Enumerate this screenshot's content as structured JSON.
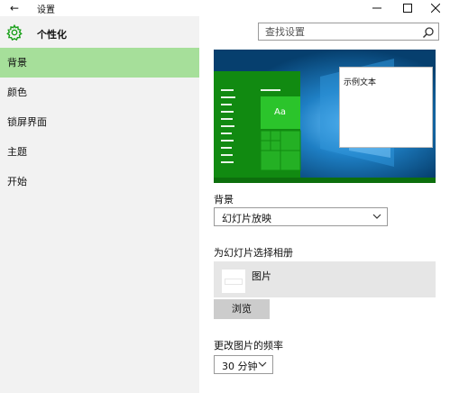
{
  "window": {
    "title": "设置",
    "back_icon": "back-arrow-icon",
    "minimize_icon": "minimize-icon",
    "maximize_icon": "maximize-icon",
    "close_icon": "close-icon"
  },
  "header": {
    "title": "个性化",
    "icon": "gear-icon",
    "accent_color": "#1aa01a"
  },
  "search": {
    "placeholder": "查找设置",
    "icon": "search-icon"
  },
  "sidebar": {
    "selected_color": "#a6df9a",
    "items": [
      {
        "label": "背景",
        "selected": true
      },
      {
        "label": "颜色",
        "selected": false
      },
      {
        "label": "锁屏界面",
        "selected": false
      },
      {
        "label": "主题",
        "selected": false
      },
      {
        "label": "开始",
        "selected": false
      }
    ]
  },
  "preview": {
    "tile_label": "Aa",
    "dialog_text": "示例文本",
    "accent_color": "#2bc42b"
  },
  "background": {
    "label": "背景",
    "value": "幻灯片放映"
  },
  "album": {
    "label": "为幻灯片选择相册",
    "folder": "图片",
    "browse_label": "浏览"
  },
  "frequency": {
    "label": "更改图片的频率",
    "value": "30 分钟"
  }
}
